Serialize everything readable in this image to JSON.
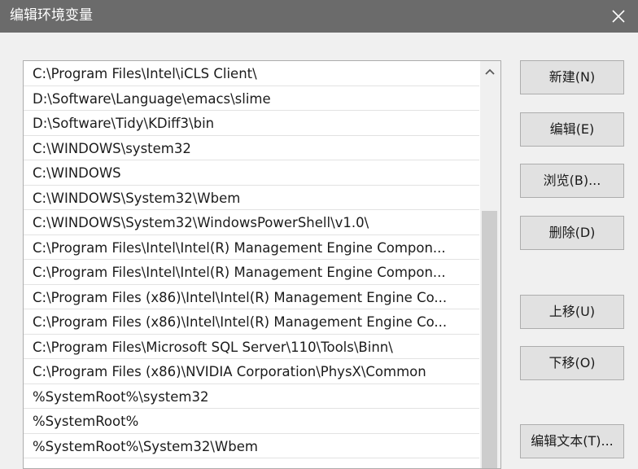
{
  "window": {
    "title": "编辑环境变量"
  },
  "paths": [
    "C:\\Program Files\\Intel\\iCLS Client\\",
    "D:\\Software\\Language\\emacs\\slime",
    "D:\\Software\\Tidy\\KDiff3\\bin",
    "C:\\WINDOWS\\system32",
    "C:\\WINDOWS",
    "C:\\WINDOWS\\System32\\Wbem",
    "C:\\WINDOWS\\System32\\WindowsPowerShell\\v1.0\\",
    "C:\\Program Files\\Intel\\Intel(R) Management Engine Compon...",
    "C:\\Program Files\\Intel\\Intel(R) Management Engine Compon...",
    "C:\\Program Files (x86)\\Intel\\Intel(R) Management Engine Co...",
    "C:\\Program Files (x86)\\Intel\\Intel(R) Management Engine Co...",
    "C:\\Program Files\\Microsoft SQL Server\\110\\Tools\\Binn\\",
    "C:\\Program Files (x86)\\NVIDIA Corporation\\PhysX\\Common",
    "%SystemRoot%\\system32",
    "%SystemRoot%",
    "%SystemRoot%\\System32\\Wbem"
  ],
  "buttons": {
    "new": "新建(N)",
    "edit": "编辑(E)",
    "browse": "浏览(B)...",
    "delete": "删除(D)",
    "move_up": "上移(U)",
    "move_down": "下移(O)",
    "edit_text": "编辑文本(T)..."
  },
  "icons": {
    "close": "close-icon",
    "scroll_up": "chevron-up-icon"
  }
}
